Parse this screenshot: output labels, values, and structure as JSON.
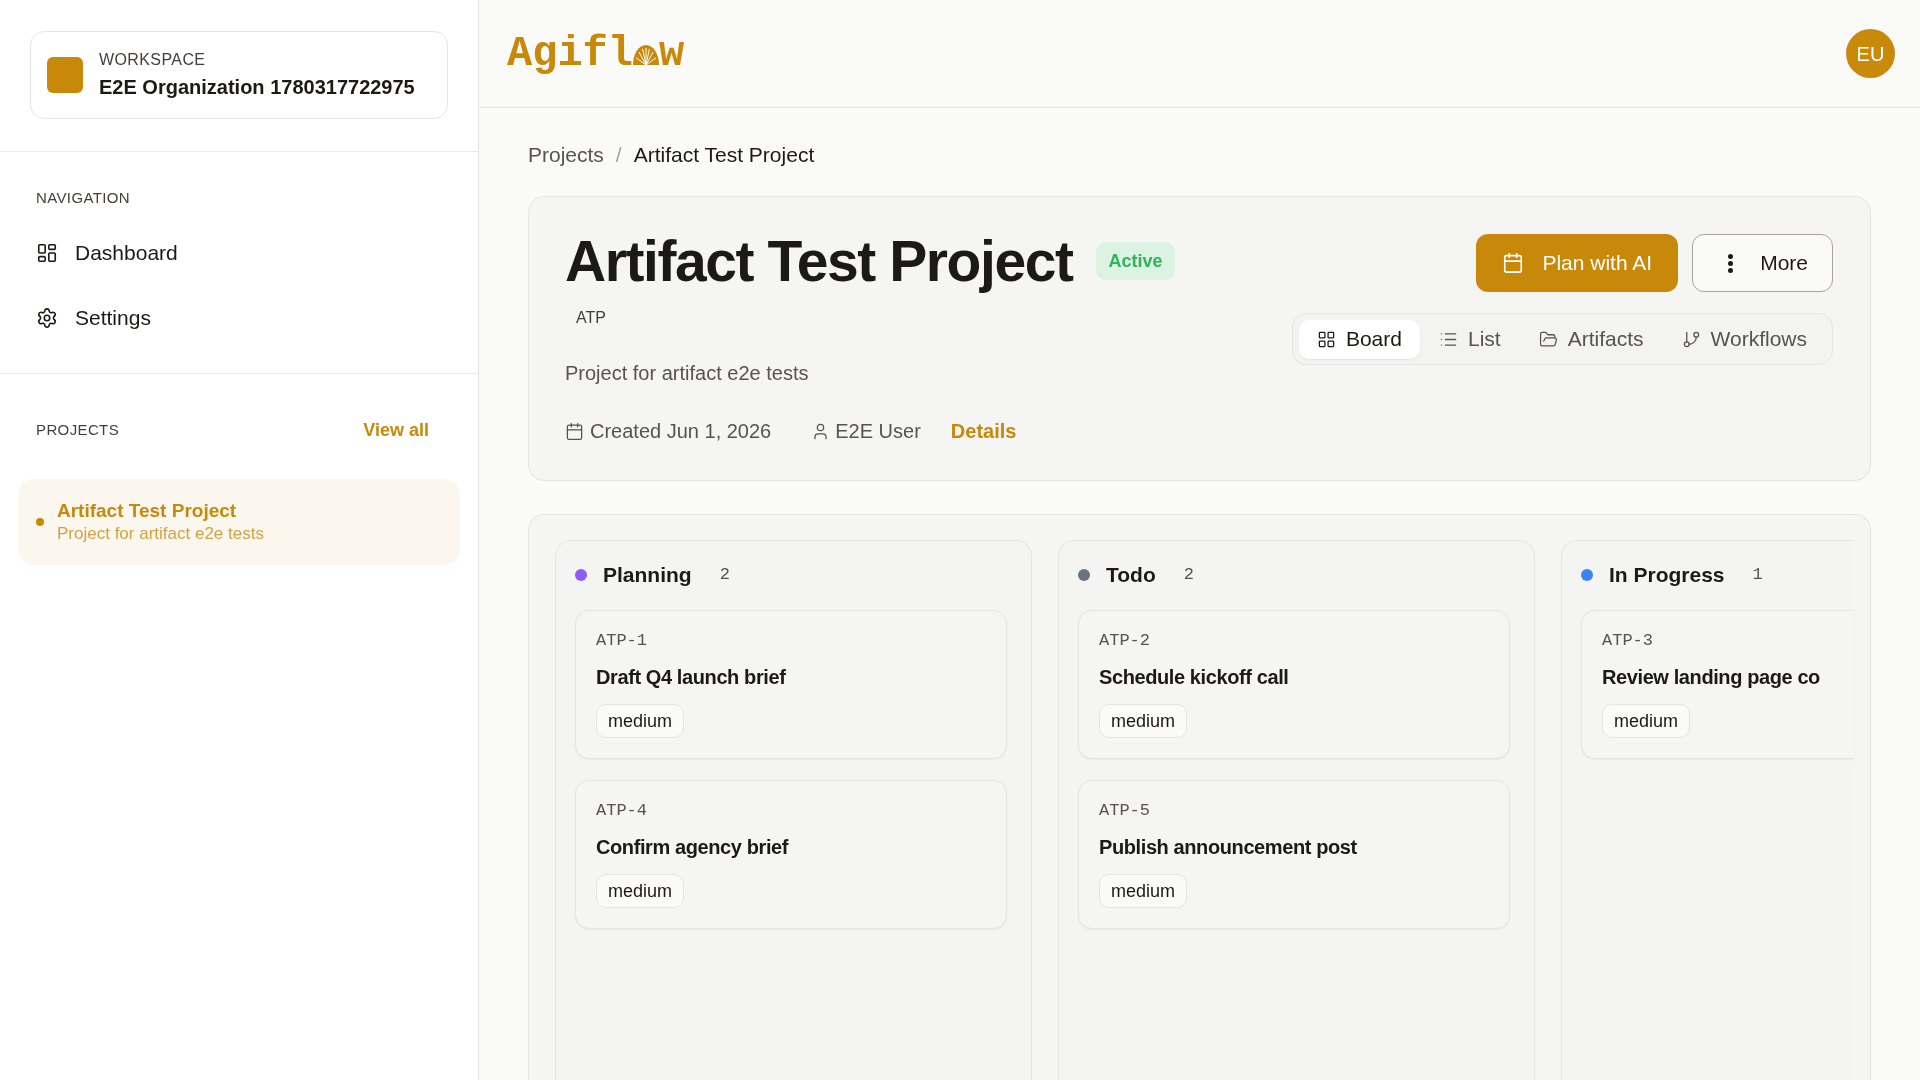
{
  "sidebar": {
    "workspace": {
      "label": "WORKSPACE",
      "name": "E2E Organization 1780317722975"
    },
    "navigation": {
      "title": "NAVIGATION",
      "items": [
        {
          "label": "Dashboard",
          "selected": false
        },
        {
          "label": "Settings",
          "selected": false
        }
      ]
    },
    "projects": {
      "title": "PROJECTS",
      "view_all": "View all",
      "items": [
        {
          "name": "Artifact Test Project",
          "description": "Project for artifact e2e tests",
          "selected": true
        }
      ]
    }
  },
  "header": {
    "logo": {
      "text_before": "Agifl",
      "text_after": "w"
    },
    "avatar": "EU"
  },
  "breadcrumb": {
    "separator": "/",
    "items": [
      {
        "label": "Projects",
        "current": false
      },
      {
        "label": "Artifact Test Project",
        "current": true
      }
    ]
  },
  "project": {
    "title": "Artifact Test Project",
    "status": "Active",
    "key": "ATP",
    "description": "Project for artifact e2e tests",
    "created": "Created Jun 1, 2026",
    "owner": "E2E User",
    "details_link": "Details",
    "actions": [
      {
        "kind": "primary",
        "label": "Plan with AI"
      },
      {
        "kind": "secondary",
        "label": "More"
      }
    ],
    "view_tabs": [
      {
        "label": "Board",
        "selected": true
      },
      {
        "label": "List",
        "selected": false
      },
      {
        "label": "Artifacts",
        "selected": false
      },
      {
        "label": "Workflows",
        "selected": false
      }
    ]
  },
  "board": {
    "columns": [
      {
        "name": "Planning",
        "count": "2",
        "color": "#8b5cf6",
        "cards": [
          {
            "id": "ATP-1",
            "title": "Draft Q4 launch brief",
            "priority": "medium"
          },
          {
            "id": "ATP-4",
            "title": "Confirm agency brief",
            "priority": "medium"
          }
        ]
      },
      {
        "name": "Todo",
        "count": "2",
        "color": "#6b7280",
        "cards": [
          {
            "id": "ATP-2",
            "title": "Schedule kickoff call",
            "priority": "medium"
          },
          {
            "id": "ATP-5",
            "title": "Publish announcement post",
            "priority": "medium"
          }
        ]
      },
      {
        "name": "In Progress",
        "count": "1",
        "color": "#3b82f6",
        "cards": [
          {
            "id": "ATP-3",
            "title": "Review landing page co",
            "priority": "medium"
          }
        ]
      }
    ]
  }
}
